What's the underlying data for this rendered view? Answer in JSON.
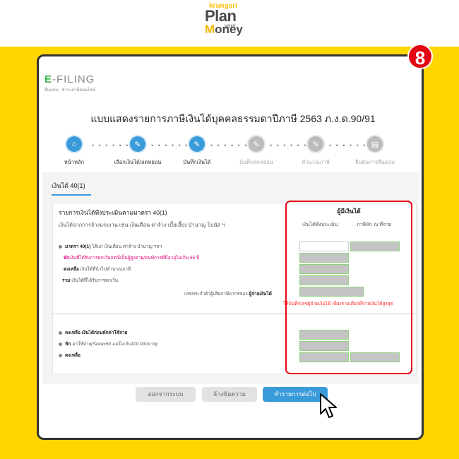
{
  "brand": {
    "top": "krungsri",
    "plan": "Plan",
    "your": "your",
    "money_m": "M",
    "money_rest": "oney"
  },
  "step_badge": "8",
  "efiling": {
    "logo_e": "E",
    "logo_rest": "-FILING",
    "subtitle": "ยื่นแบบ - ชำระภาษีออนไลน์"
  },
  "page_title": "แบบแสดงรายการภาษีเงินได้บุคคลธรรมดาปีภาษี 2563 ภ.ง.ด.90/91",
  "steps": [
    {
      "label": "หน้าหลัก",
      "icon": "home-icon",
      "state": "active"
    },
    {
      "label": "เลือกเงินได้/ลดหย่อน",
      "icon": "edit-document-icon",
      "state": "active"
    },
    {
      "label": "บันทึกเงินได้",
      "icon": "edit-document-icon",
      "state": "active"
    },
    {
      "label": "บันทึกลดหย่อน",
      "icon": "edit-document-icon",
      "state": "inactive"
    },
    {
      "label": "คำนวณภาษี",
      "icon": "calculate-icon",
      "state": "inactive"
    },
    {
      "label": "ยืนยันการยื่นแบบ",
      "icon": "confirm-document-icon",
      "state": "inactive"
    }
  ],
  "step_separator": "• • • • • • • •",
  "tab_label": "เงินได้ 40(1)",
  "panel": {
    "title": "รายการเงินได้พึงประเมินตามมาตรา 40(1)",
    "description": "เงินได้จากการจ้างแรงงาน เช่น เงินเดือน ค่าจ้าง เบี้ยเลี้ยง บำนาญ โบนัส ฯ",
    "rows": {
      "r1_bold": "มาตรา 40(1)",
      "r1_text": " ได้แก่ เงินเดือน ค่าจ้าง บำนาญ ฯลฯ",
      "r2_bold": "หัก",
      "r2_text": "เงินที่ได้รับการยกเว้นกรณีเป็นผู้สูงอายุ/คนพิการที่มีอายุไม่เกิน 65 ปี",
      "r3_bold": "คงเหลือ",
      "r3_text": " เงินได้ที่นำไปคำนวณภาษี",
      "r4_bold": "รวม",
      "r4_text": " เงินได้ที่ได้รับการยกเว้น",
      "payer_text": "เลขประจำตัวผู้เสียภาษีอากรของ ",
      "payer_bold": "ผู้จ่ายเงินได้",
      "note": "ให้บันทึกเลขผู้จ่ายเงินได้ เพียงรายเดียวที่จ่ายเงินได้สูงสุด",
      "r5_bold": "คงเหลือ  เงินได้ก่อนหักค่าใช้จ่าย",
      "r6_bold": "หัก",
      "r6_text": " ค่าใช้จ่าย(ร้อยละ50 แต่ไม่เกิน100,000บาท)",
      "r7_bold": "คงเหลือ"
    },
    "columns": {
      "head": "ผู้มีเงินได้",
      "col1": "เงินได้พึงประเมิน",
      "col2": "ภาษีหัก ณ ที่จ่าย"
    },
    "fields": {
      "income_40_1": "",
      "withholding_40_1": "",
      "exempt_elderly": "",
      "remaining_taxable": "",
      "total_exempt": "",
      "payer_tax_id": "",
      "remaining_before_expense": "",
      "expense_deduction": "",
      "remaining_income": "",
      "remaining_withholding": ""
    }
  },
  "buttons": {
    "logout": "ออกจากระบบ",
    "clear": "ล้างข้อความ",
    "next": "ทำรายการต่อไป"
  }
}
